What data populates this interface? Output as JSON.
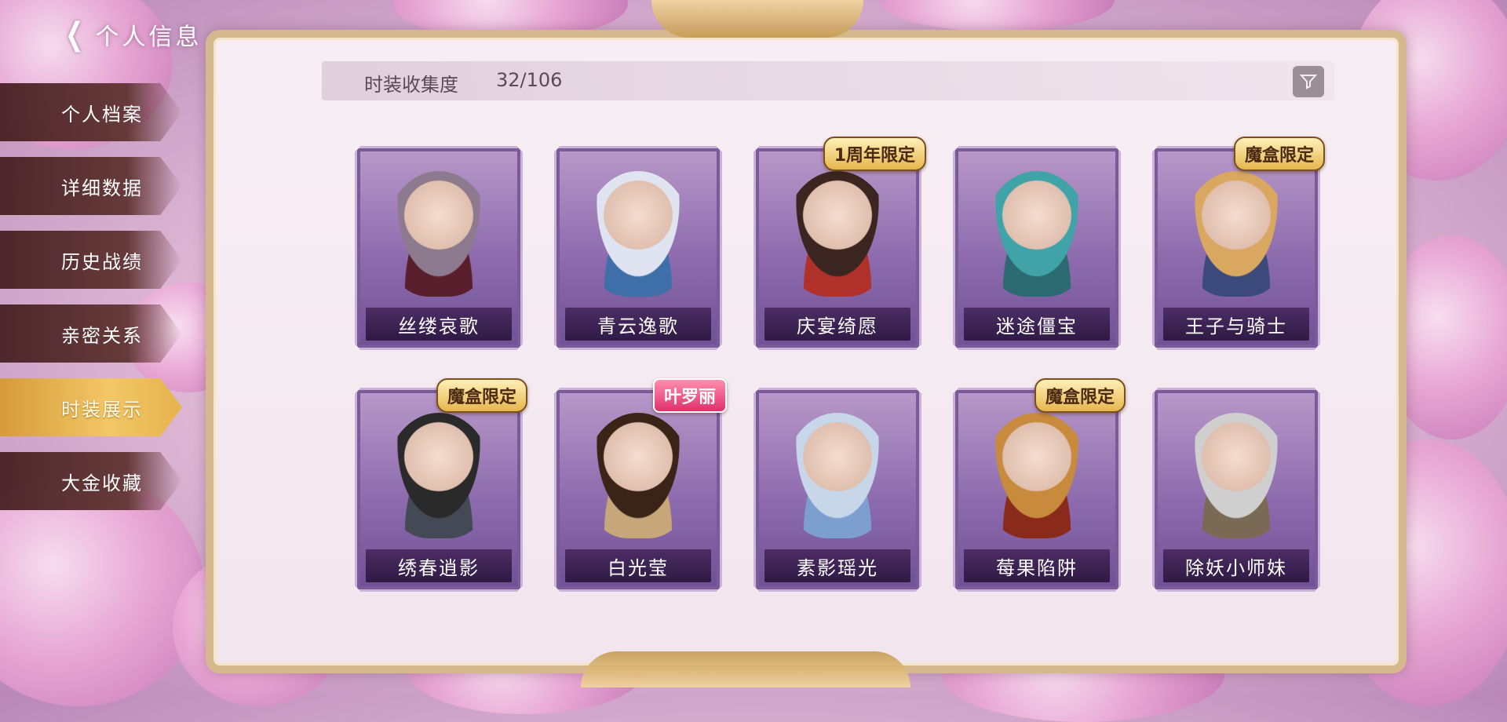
{
  "header": {
    "title": "个人信息"
  },
  "sidebar": {
    "items": [
      {
        "label": "个人档案"
      },
      {
        "label": "详细数据"
      },
      {
        "label": "历史战绩"
      },
      {
        "label": "亲密关系"
      },
      {
        "label": "时装展示"
      },
      {
        "label": "大金收藏"
      }
    ],
    "active_index": 4
  },
  "collection": {
    "label": "时装收集度",
    "count": "32/106"
  },
  "costumes": [
    {
      "name": "丝缕哀歌",
      "badge": "",
      "hair": "#8d7a8f",
      "cloth": "#5a1f2d"
    },
    {
      "name": "青云逸歌",
      "badge": "",
      "hair": "#dfe4f0",
      "cloth": "#3f6fa8"
    },
    {
      "name": "庆宴绮愿",
      "badge": "1周年限定",
      "hair": "#3a2520",
      "cloth": "#b0302a"
    },
    {
      "name": "迷途僵宝",
      "badge": "",
      "hair": "#3fa3a8",
      "cloth": "#2a6a70"
    },
    {
      "name": "王子与骑士",
      "badge": "魔盒限定",
      "hair": "#d9a760",
      "cloth": "#3b4a7a"
    },
    {
      "name": "绣春逍影",
      "badge": "魔盒限定",
      "hair": "#2a2a2a",
      "cloth": "#444a55"
    },
    {
      "name": "白光莹",
      "badge": "叶罗丽",
      "hair": "#3a2418",
      "cloth": "#c7a77a"
    },
    {
      "name": "素影瑶光",
      "badge": "",
      "hair": "#c8d6ea",
      "cloth": "#7c9fcf"
    },
    {
      "name": "莓果陷阱",
      "badge": "魔盒限定",
      "hair": "#c88a3c",
      "cloth": "#8a2a1a"
    },
    {
      "name": "除妖小师妹",
      "badge": "",
      "hair": "#cfcfcf",
      "cloth": "#7a6a55"
    }
  ],
  "colors": {
    "accent": "#e6b24d",
    "nav_bg": "#5c2f30",
    "card_bg": "#8d6bae"
  }
}
